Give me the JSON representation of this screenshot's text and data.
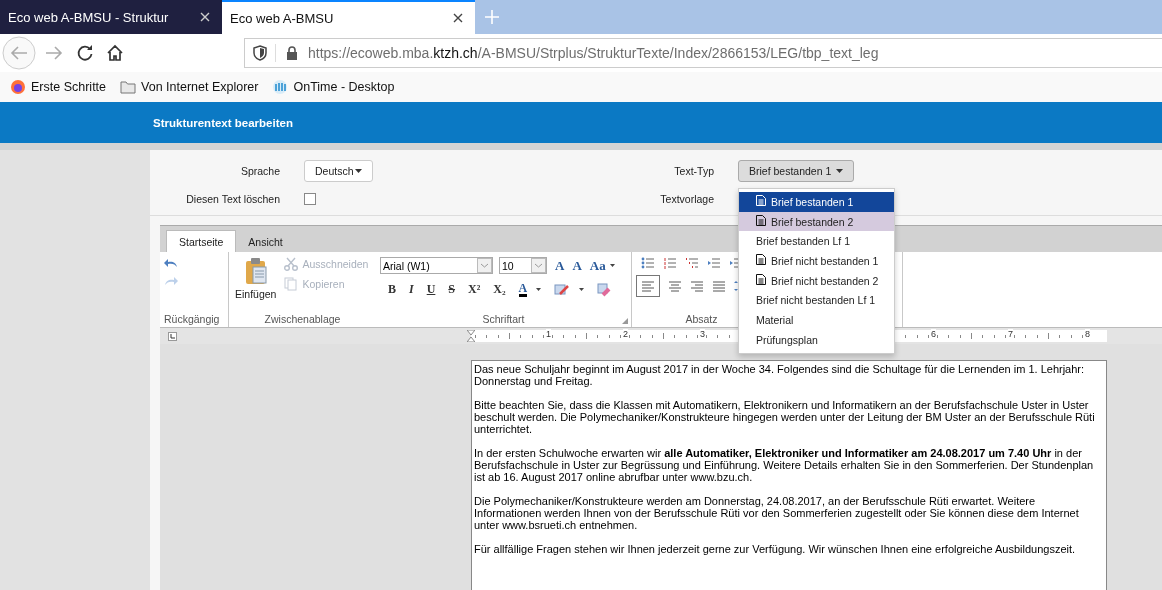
{
  "browser": {
    "tabs": [
      {
        "title": "Eco web A-BMSU - Struktur",
        "selected": false
      },
      {
        "title": "Eco web A-BMSU",
        "selected": true
      }
    ],
    "url": {
      "prefix": "https://ecoweb.mba.",
      "domain": "ktzh.ch",
      "path": "/A-BMSU/Strplus/StrukturTexte/Index/2866153/LEG/tbp_text_leg"
    },
    "bookmarks": [
      {
        "label": "Erste Schritte",
        "kind": "firefox"
      },
      {
        "label": "Von Internet Explorer",
        "kind": "folder"
      },
      {
        "label": "OnTime - Desktop",
        "kind": "app"
      }
    ]
  },
  "page_header": {
    "title": "Strukturentext bearbeiten"
  },
  "form": {
    "language_label": "Sprache",
    "language_value": "Deutsch",
    "text_type_label": "Text-Typ",
    "text_type_value": "Brief bestanden 1",
    "delete_label": "Diesen Text löschen",
    "delete_checked": false,
    "template_label": "Textvorlage"
  },
  "dropdown": {
    "items": [
      {
        "label": "Brief bestanden 1",
        "icon": true,
        "selected": true,
        "hovered": false
      },
      {
        "label": "Brief bestanden 2",
        "icon": true,
        "selected": false,
        "hovered": true
      },
      {
        "label": "Brief bestanden Lf 1",
        "icon": false,
        "selected": false,
        "hovered": false
      },
      {
        "label": "Brief nicht bestanden 1",
        "icon": true,
        "selected": false,
        "hovered": false
      },
      {
        "label": "Brief nicht bestanden 2",
        "icon": true,
        "selected": false,
        "hovered": false
      },
      {
        "label": "Brief nicht bestanden Lf 1",
        "icon": false,
        "selected": false,
        "hovered": false
      },
      {
        "label": "Material",
        "icon": false,
        "selected": false,
        "hovered": false
      },
      {
        "label": "Prüfungsplan",
        "icon": false,
        "selected": false,
        "hovered": false
      }
    ]
  },
  "editor": {
    "tabs": [
      {
        "label": "Startseite",
        "selected": true
      },
      {
        "label": "Ansicht",
        "selected": false
      }
    ],
    "groups": [
      "Rückgängig",
      "Zwischenablage",
      "Schriftart",
      "Absatz"
    ],
    "clipboard": {
      "paste": "Einfügen",
      "cut": "Ausschneiden",
      "copy": "Kopieren"
    },
    "font": {
      "name": "Arial (W1)",
      "size": "10"
    },
    "size_buttons": [
      "A",
      "A",
      "Aa"
    ],
    "format_buttons": [
      {
        "label": "B",
        "kind": "bold"
      },
      {
        "label": "I",
        "kind": "italic"
      },
      {
        "label": "U",
        "kind": "underline"
      },
      {
        "label": "S",
        "kind": "strike"
      },
      {
        "label": "X²",
        "kind": "plain"
      },
      {
        "label": "X₂",
        "kind": "plain"
      },
      {
        "label": "A",
        "kind": "color"
      }
    ],
    "ruler": [
      {
        "label": "1"
      },
      {
        "label": "2"
      },
      {
        "label": "3"
      },
      {
        "covered": true
      },
      {
        "covered": true
      },
      {
        "label": "6"
      },
      {
        "label": "7"
      },
      {
        "label": "8"
      }
    ],
    "paragraphs": [
      "Das neue Schuljahr beginnt im August 2017 in der Woche 34. Folgendes sind die Schultage für die Lernenden im 1. Lehrjahr: Donnerstag und Freitag.",
      "Bitte beachten Sie, dass die Klassen mit Automatikern, Elektronikern und Informatikern an der Berufsfachschule Uster in Uster beschult werden. Die Polymechaniker/Konstrukteure hingegen werden unter der Leitung der BM Uster an der Berufsschule Rüti unterrichtet.",
      "In der ersten Schulwoche erwarten wir **alle Automatiker, Elektroniker und Informatiker am 24.08.2017 um 7.40 Uhr** in der Berufsfachschule in Uster zur Begrüssung und Einführung. Weitere Details erhalten Sie in den Sommerferien. Der Stundenplan ist ab 16. August 2017 online abrufbar unter www.bzu.ch.",
      "Die Polymechaniker/Konstrukteure werden am Donnerstag, 24.08.2017, an der Berufsschule Rüti erwartet. Weitere Informationen werden Ihnen von der Berufsschule Rüti vor den Sommerferien zugestellt oder Sie können diese dem Internet unter www.bsrueti.ch entnehmen.",
      "Für allfällige Fragen stehen wir Ihnen jederzeit gerne zur Verfügung. Wir wünschen Ihnen eine erfolgreiche Ausbildungszeit."
    ]
  }
}
